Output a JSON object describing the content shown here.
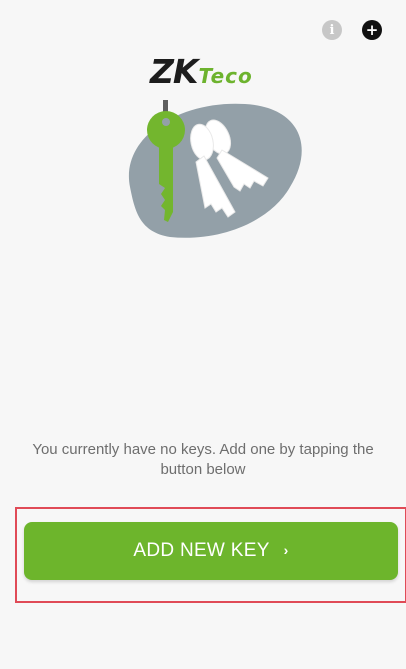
{
  "header": {
    "info_icon": "info-icon",
    "info_glyph": "i",
    "add_icon": "plus-circle-icon",
    "add_glyph": "+"
  },
  "logo": {
    "part1": "ZK",
    "part2": "Teco"
  },
  "empty_state": {
    "message": "You currently have no keys. Add one by tapping the button below"
  },
  "add_button": {
    "label": "ADD NEW KEY",
    "chevron": "›"
  },
  "colors": {
    "accent": "#6db52c",
    "highlight": "#e04b57",
    "background": "#f7f7f7"
  }
}
